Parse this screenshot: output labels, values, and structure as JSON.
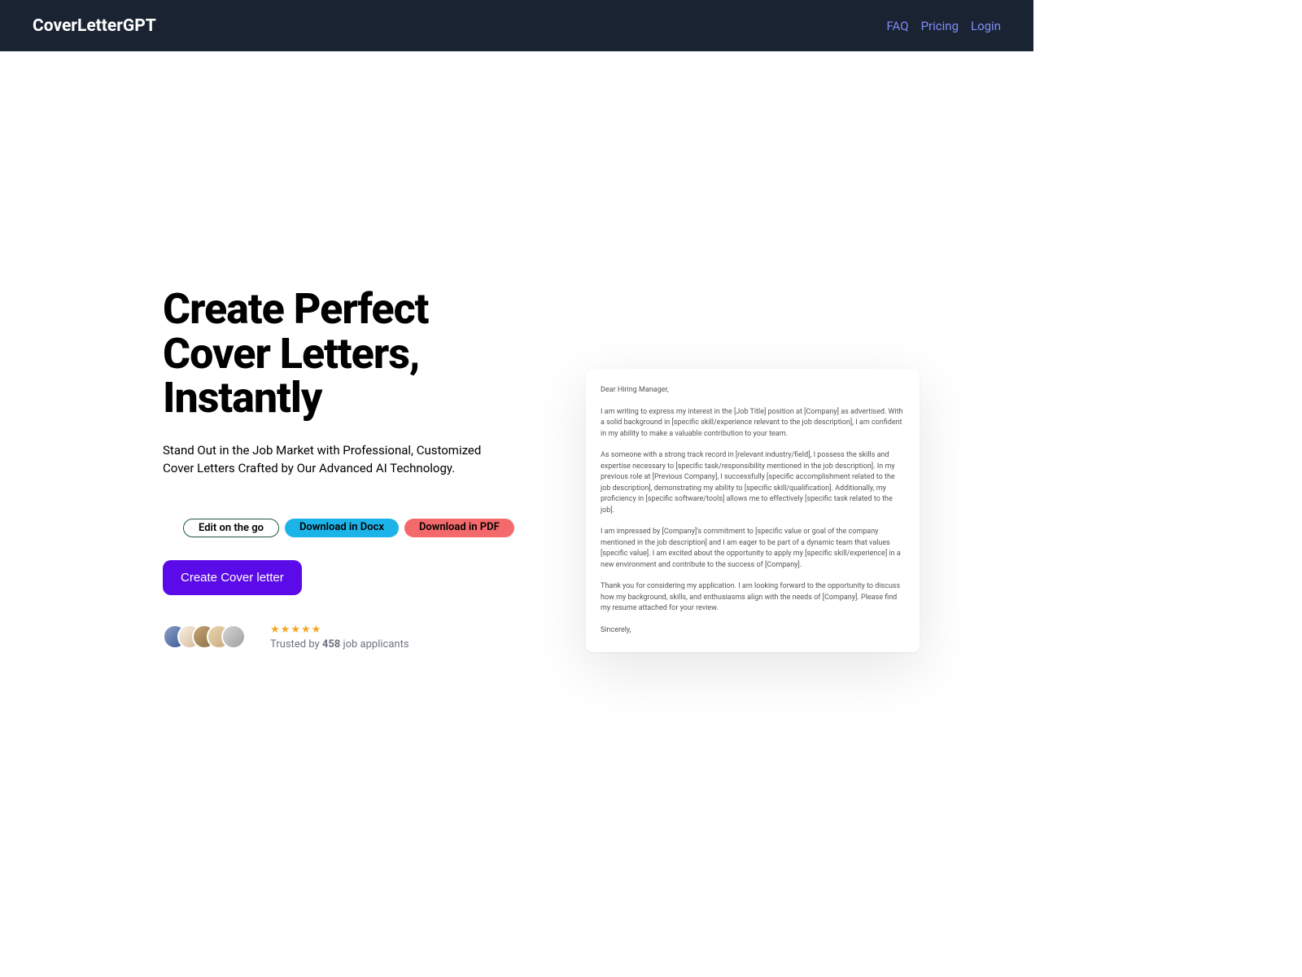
{
  "header": {
    "logo": "CoverLetterGPT",
    "nav": {
      "faq": "FAQ",
      "pricing": "Pricing",
      "login": "Login"
    }
  },
  "hero": {
    "title": "Create Perfect Cover Letters, Instantly",
    "subtitle": "Stand Out in the Job Market with Professional, Customized Cover Letters Crafted by Our Advanced AI Technology.",
    "pills": {
      "edit": "Edit on the go",
      "docx": "Download in Docx",
      "pdf": "Download in PDF"
    },
    "cta": "Create Cover letter",
    "trust": {
      "prefix": "Trusted by ",
      "count": "458",
      "suffix": " job applicants"
    }
  },
  "letter": {
    "greeting": "Dear Hiring Manager,",
    "p1": "I am writing to express my interest in the [Job Title] position at [Company] as advertised. With a solid background in [specific skill/experience relevant to the job description], I am confident in my ability to make a valuable contribution to your team.",
    "p2": "As someone with a strong track record in [relevant industry/field], I possess the skills and expertise necessary to [specific task/responsibility mentioned in the job description]. In my previous role at [Previous Company], I successfully [specific accomplishment related to the job description], demonstrating my ability to [specific skill/qualification]. Additionally, my proficiency in [specific software/tools] allows me to effectively [specific task related to the job].",
    "p3": "I am impressed by [Company]'s commitment to [specific value or goal of the company mentioned in the job description] and I am eager to be part of a dynamic team that values [specific value]. I am excited about the opportunity to apply my [specific skill/experience] in a new environment and contribute to the success of [Company].",
    "p4": "Thank you for considering my application. I am looking forward to the opportunity to discuss how my background, skills, and enthusiasms align with the needs of [Company]. Please find my resume attached for your review.",
    "closing": "Sincerely,"
  }
}
